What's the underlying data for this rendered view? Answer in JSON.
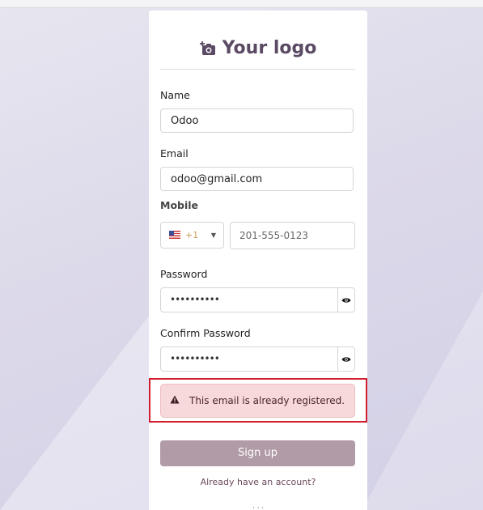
{
  "brand": {
    "logo_text": "Your logo",
    "icon": "camera-plus-icon"
  },
  "form": {
    "name": {
      "label": "Name",
      "value": "Odoo"
    },
    "email": {
      "label": "Email",
      "value": "odoo@gmail.com"
    },
    "mobile": {
      "label": "Mobile",
      "country_code": "+1",
      "country_flag": "us-flag-icon",
      "placeholder": "201-555-0123"
    },
    "password": {
      "label": "Password",
      "value": "••••••••••"
    },
    "confirm_password": {
      "label": "Confirm Password",
      "value": "••••••••••"
    }
  },
  "alert": {
    "message": "This email is already registered.",
    "icon": "warning-triangle-icon"
  },
  "actions": {
    "signup_label": "Sign up",
    "login_link": "Already have an account?"
  },
  "colors": {
    "accent": "#b19ba7",
    "alert_bg": "#f7d9db",
    "highlight_border": "#d11f2f"
  }
}
